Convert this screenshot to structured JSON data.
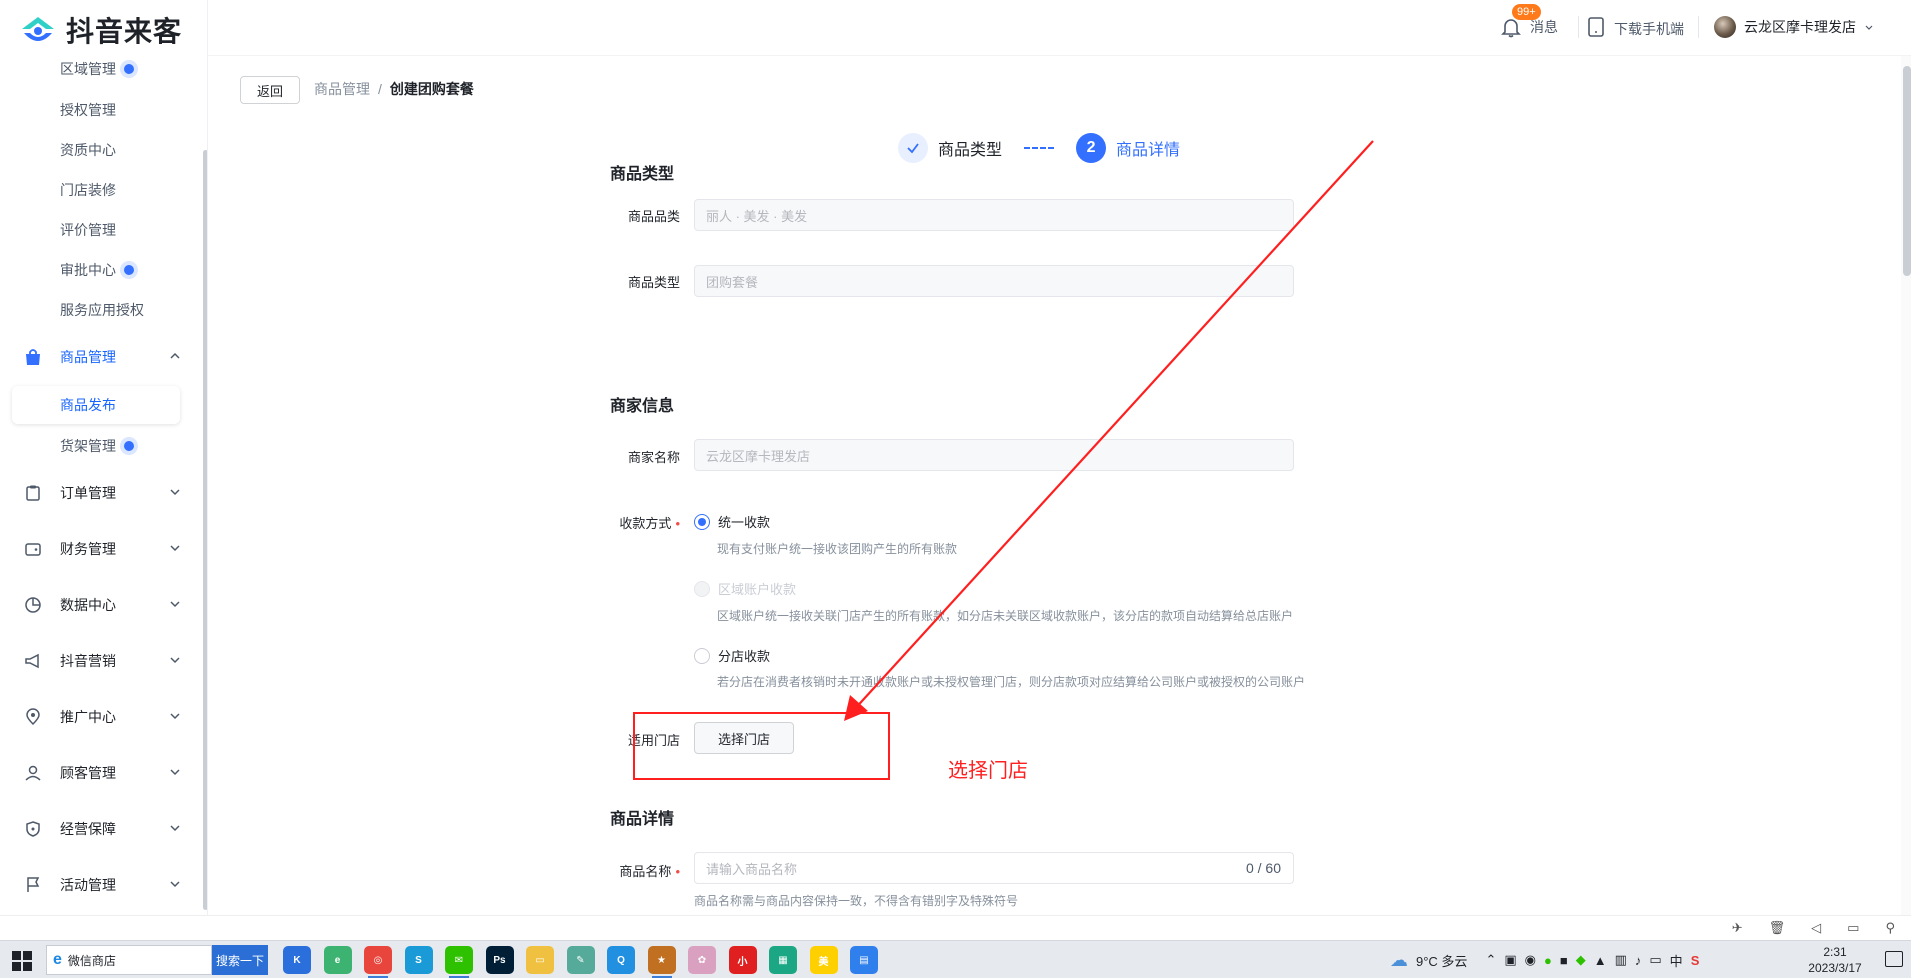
{
  "app": {
    "name": "抖音来客"
  },
  "sidebar": {
    "sub_items_top": [
      {
        "label": "区域管理",
        "dot": true
      },
      {
        "label": "授权管理",
        "dot": false
      },
      {
        "label": "资质中心",
        "dot": false
      },
      {
        "label": "门店装修",
        "dot": false
      },
      {
        "label": "评价管理",
        "dot": false
      },
      {
        "label": "审批中心",
        "dot": true
      },
      {
        "label": "服务应用授权",
        "dot": false
      }
    ],
    "product_menu": {
      "label": "商品管理",
      "icon": "bag-icon"
    },
    "product_sub": [
      {
        "label": "商品发布",
        "active": true
      },
      {
        "label": "货架管理",
        "dot": true
      }
    ],
    "menus": [
      {
        "label": "订单管理",
        "icon": "clipboard-icon"
      },
      {
        "label": "财务管理",
        "icon": "wallet-icon"
      },
      {
        "label": "数据中心",
        "icon": "pie-icon"
      },
      {
        "label": "抖音营销",
        "icon": "megaphone-icon"
      },
      {
        "label": "推广中心",
        "icon": "location-icon"
      },
      {
        "label": "顾客管理",
        "icon": "user-icon"
      },
      {
        "label": "经营保障",
        "icon": "shield-icon"
      },
      {
        "label": "活动管理",
        "icon": "flag-icon"
      }
    ]
  },
  "header": {
    "messages_label": "消息",
    "messages_badge": "99+",
    "download_label": "下载手机端",
    "store_name": "云龙区摩卡理发店"
  },
  "page": {
    "back_label": "返回",
    "breadcrumb_parent": "商品管理",
    "breadcrumb_sep": "/",
    "breadcrumb_current": "创建团购套餐",
    "steps": [
      {
        "label": "商品类型",
        "state": "done"
      },
      {
        "label": "商品详情",
        "state": "current",
        "number": "2"
      }
    ],
    "section_type": {
      "title": "商品类型",
      "category_label": "商品品类",
      "category_value": "丽人 · 美发 · 美发",
      "type_label": "商品类型",
      "type_value": "团购套餐"
    },
    "section_merchant": {
      "title": "商家信息",
      "merchant_name_label": "商家名称",
      "merchant_name_value": "云龙区摩卡理发店",
      "payment_label": "收款方式",
      "payment_options": [
        {
          "label": "统一收款",
          "hint": "现有支付账户统一接收该团购产生的所有账款",
          "selected": true,
          "disabled": false
        },
        {
          "label": "区域账户收款",
          "hint": "区域账户统一接收关联门店产生的所有账款，如分店未关联区域收款账户，该分店的款项自动结算给总店账户",
          "selected": false,
          "disabled": true
        },
        {
          "label": "分店收款",
          "hint": "若分店在消费者核销时未开通收款账户或未授权管理门店，则分店款项对应结算给公司账户或被授权的公司账户",
          "selected": false,
          "disabled": false
        }
      ],
      "store_label": "适用门店",
      "store_button": "选择门店"
    },
    "section_detail": {
      "title": "商品详情",
      "name_label": "商品名称",
      "name_placeholder": "请输入商品名称",
      "name_count": "0 / 60",
      "name_hint": "商品名称需与商品内容保持一致，不得含有错别字及特殊符号"
    },
    "annotation_text": "选择门店"
  },
  "taskbar": {
    "search_text": "微信商店",
    "search_button": "搜索一下",
    "weather": "9°C  多云",
    "ime": "中",
    "time": "2:31",
    "date": "2023/3/17",
    "apps": [
      {
        "name": "kuaishou-icon",
        "color": "#2a6fdb",
        "glyph": "K"
      },
      {
        "name": "browser-green-icon",
        "color": "#3cb371",
        "glyph": "e"
      },
      {
        "name": "chrome-icon",
        "color": "#e8453c",
        "glyph": "◎"
      },
      {
        "name": "shield-app-icon",
        "color": "#1a9bd7",
        "glyph": "S"
      },
      {
        "name": "wechat-icon",
        "color": "#2dc100",
        "glyph": "✉"
      },
      {
        "name": "photoshop-icon",
        "color": "#001e36",
        "glyph": "Ps"
      },
      {
        "name": "folder-icon",
        "color": "#f0c040",
        "glyph": "▭"
      },
      {
        "name": "notes-icon",
        "color": "#5a9",
        "glyph": "✎"
      },
      {
        "name": "qq-icon",
        "color": "#2290e0",
        "glyph": "Q"
      },
      {
        "name": "game-icon",
        "color": "#c07020",
        "glyph": "★"
      },
      {
        "name": "flower-app-icon",
        "color": "#d9a0c0",
        "glyph": "✿"
      },
      {
        "name": "xiaohongshu-icon",
        "color": "#e02020",
        "glyph": "小"
      },
      {
        "name": "calendar-icon",
        "color": "#1ba784",
        "glyph": "▦"
      },
      {
        "name": "meituan-icon",
        "color": "#ffd000",
        "glyph": "美"
      },
      {
        "name": "doc-icon",
        "color": "#2f80ed",
        "glyph": "▤"
      }
    ]
  }
}
